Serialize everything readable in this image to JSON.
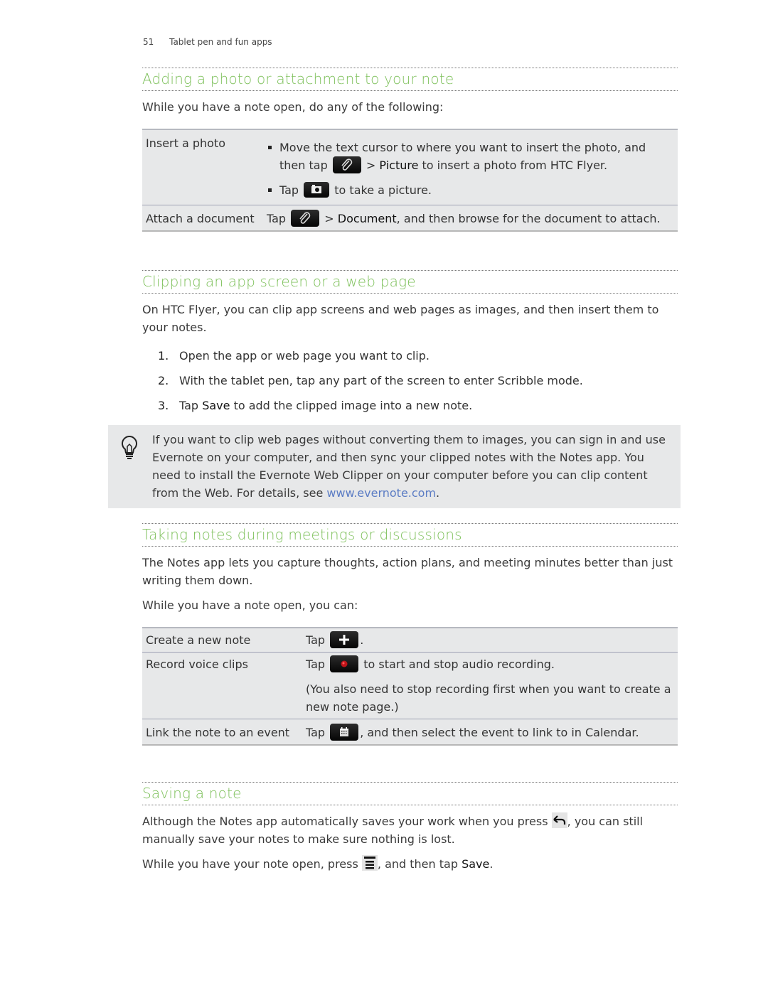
{
  "header": {
    "page_number": "51",
    "chapter": "Tablet pen and fun apps"
  },
  "section1": {
    "title": "Adding a photo or attachment to your note",
    "intro": "While you have a note open, do any of the following:",
    "rows": [
      {
        "label": "Insert a photo",
        "bullet1_a": "Move the text cursor to where you want to insert the photo, and then tap",
        "bullet1_b": ">",
        "bullet1_bold": "Picture",
        "bullet1_c": "to insert a photo from HTC Flyer.",
        "bullet2_a": "Tap",
        "bullet2_b": "to take a picture.",
        "icon1": "paperclip-icon",
        "icon2": "camera-icon"
      },
      {
        "label": "Attach a document",
        "text_a": "Tap",
        "text_b": ">",
        "text_bold": "Document",
        "text_c": ", and then browse for the document to attach.",
        "icon": "paperclip-icon"
      }
    ]
  },
  "section2": {
    "title": "Clipping an app screen or a web page",
    "intro": "On HTC Flyer, you can clip app screens and web pages as images, and then insert them to your notes.",
    "steps": [
      {
        "n": "1.",
        "text": "Open the app or web page you want to clip."
      },
      {
        "n": "2.",
        "text": "With the tablet pen, tap any part of the screen to enter Scribble mode."
      },
      {
        "n": "3.",
        "text_a": "Tap",
        "bold": "Save",
        "text_b": "to add the clipped image into a new note."
      }
    ],
    "tip": {
      "icon": "lightbulb-icon",
      "text": "If you want to clip web pages without converting them to images, you can sign in and use Evernote on your computer, and then sync your clipped notes with the Notes app. You need to install the Evernote Web Clipper on your computer before you can clip content from the Web. For details, see",
      "link": "www.evernote.com",
      "end": "."
    }
  },
  "section3": {
    "title": "Taking notes during meetings or discussions",
    "intro": "The Notes app lets you capture thoughts, action plans, and meeting minutes better than just writing them down.",
    "intro2": "While you have a note open, you can:",
    "rows": [
      {
        "label": "Create a new note",
        "text_a": "Tap",
        "text_b": ".",
        "icon": "plus-icon"
      },
      {
        "label": "Record voice clips",
        "text_a": "Tap",
        "text_b": "to start and stop audio recording.",
        "text_c": "(You also need to stop recording first when you want to create a new note page.)",
        "icon": "record-icon"
      },
      {
        "label": "Link the note to an event",
        "text_a": "Tap",
        "text_b": ", and then select the event to link to in Calendar.",
        "icon": "calendar-icon"
      }
    ]
  },
  "section4": {
    "title": "Saving a note",
    "p1_a": "Although the Notes app automatically saves your work when you press",
    "p1_b": ", you can still manually save your notes to make sure nothing is lost.",
    "p2_a": "While you have your note open, press",
    "p2_b": ", and then tap",
    "p2_bold": "Save",
    "p2_c": ".",
    "icon_back": "back-arrow-icon",
    "icon_menu": "menu-icon"
  },
  "colors": {
    "heading": "#7dc05a",
    "link": "#5b7cc4",
    "table_bg": "#e7e8e9"
  }
}
